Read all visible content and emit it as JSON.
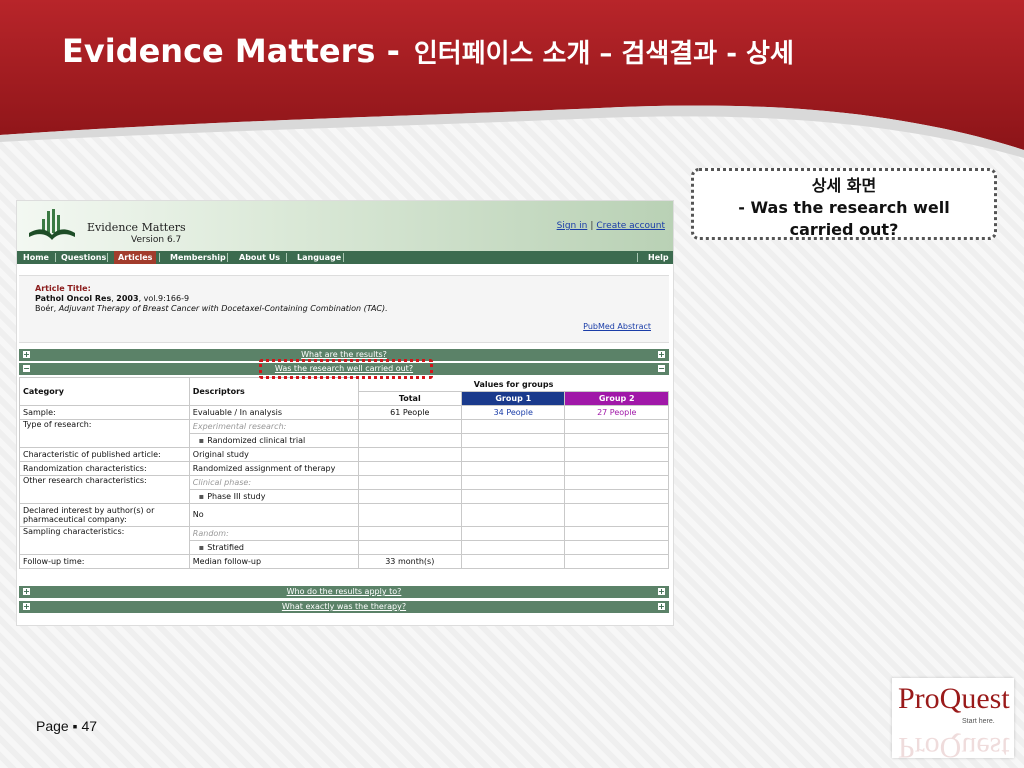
{
  "slide": {
    "title": "Evidence Matters -",
    "title_kr": "인터페이스 소개 – 검색결과 - 상세",
    "page": "Page ▪ 47",
    "callout_line1": "상세 화면",
    "callout_line2": "- Was the research well",
    "callout_line3": "carried out?"
  },
  "app": {
    "name": "Evidence Matters",
    "version": "Version 6.7",
    "sign_in": "Sign in",
    "create_account": "Create account",
    "nav": [
      "Home",
      "Questions",
      "Articles",
      "Membership",
      "About Us",
      "Language"
    ],
    "nav_active_index": 2,
    "help": "Help"
  },
  "article": {
    "label": "Article Title:",
    "journal": "Pathol Oncol Res",
    "year": "2003",
    "citation_rest": ", vol.9:166-9",
    "author": "Boér,",
    "title": "Adjuvant Therapy of Breast Cancer with Docetaxel-Containing Combination (TAC).",
    "pubmed": "PubMed Abstract"
  },
  "sections": {
    "results": "What are the results?",
    "research": "Was the research well carried out?",
    "apply": "Who do the results apply to?",
    "therapy": "What exactly was the therapy?"
  },
  "table": {
    "col_category": "Category",
    "col_descriptors": "Descriptors",
    "values_for_groups": "Values for groups",
    "col_total": "Total",
    "col_group1": "Group 1",
    "col_group2": "Group 2",
    "rows": {
      "sample_cat": "Sample:",
      "sample_desc": "Evaluable / In analysis",
      "sample_total": "61 People",
      "sample_g1": "34 People",
      "sample_g2": "27 People",
      "type_cat": "Type of research:",
      "type_desc": "Experimental research:",
      "type_sub": "Randomized clinical trial",
      "char_cat": "Characteristic of published article:",
      "char_desc": "Original study",
      "rand_cat": "Randomization characteristics:",
      "rand_desc": "Randomized assignment of therapy",
      "other_cat": "Other research characteristics:",
      "other_desc": "Clinical phase:",
      "other_sub": "Phase III study",
      "decl_cat1": "Declared interest by author(s) or",
      "decl_cat2": "pharmaceutical company:",
      "decl_desc": "No",
      "samp_cat": "Sampling characteristics:",
      "samp_desc": "Random:",
      "samp_sub": "Stratified",
      "fu_cat": "Follow-up time:",
      "fu_desc": "Median follow-up",
      "fu_total": "33 month(s)"
    }
  },
  "logo": {
    "text": "ProQuest",
    "tagline": "Start here."
  },
  "colors": {
    "header_red": "#a31d22",
    "nav_green": "#3c6b4f",
    "group1": "#1a3a8c",
    "group2": "#a018a8",
    "highlight": "#d4141a"
  }
}
